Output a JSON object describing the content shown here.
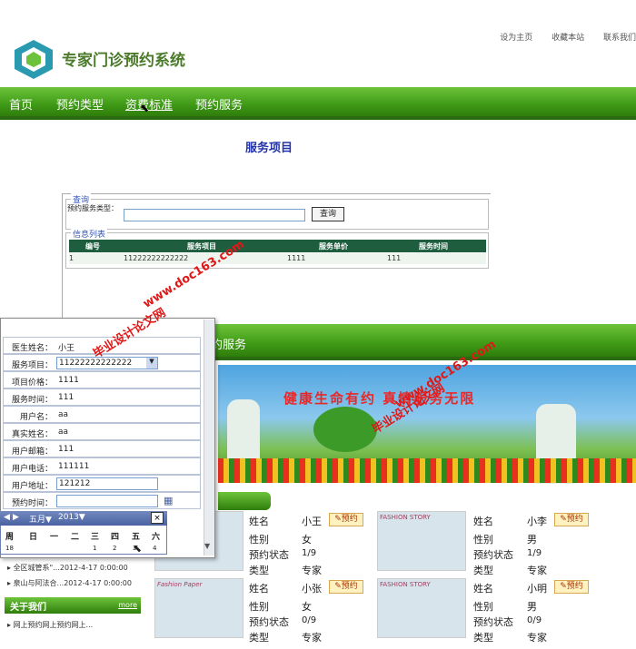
{
  "top": {
    "links": [
      "设为主页",
      "收藏本站",
      "联系我们"
    ],
    "site_title": "专家门诊预约系统",
    "nav": [
      "首页",
      "预约类型",
      "资费标准",
      "预约服务"
    ],
    "page_title": "服务项目",
    "query_legend": "查询",
    "query_label": "预约服务类型：",
    "query_button": "查询",
    "list_legend": "信息列表",
    "columns": [
      "编号",
      "服务项目",
      "服务单价",
      "服务时间"
    ],
    "rows": [
      [
        "1",
        "11222222222222",
        "1111",
        "111"
      ]
    ]
  },
  "watermarks": [
    "www.doc163.com",
    "毕业设计论文网",
    "www.doc163.com",
    "毕业设计论文网"
  ],
  "bottom": {
    "nav_partial": "约服务",
    "banner_text": "健康生命有约 真情服务无限",
    "form": [
      {
        "label": "医生姓名：",
        "value": "小王"
      },
      {
        "label": "服务项目：",
        "value": "11222222222222"
      },
      {
        "label": "项目价格：",
        "value": "1111"
      },
      {
        "label": "服务时间：",
        "value": "111"
      },
      {
        "label": "用户名：",
        "value": "aa"
      },
      {
        "label": "真实姓名：",
        "value": "aa"
      },
      {
        "label": "用户邮箱：",
        "value": "111"
      },
      {
        "label": "用户电话：",
        "value": "111111"
      },
      {
        "label": "用户地址：",
        "value": "121212"
      },
      {
        "label": "预约时间：",
        "value": ""
      }
    ],
    "calendar": {
      "month": "五月",
      "year": "2013",
      "weekdays": [
        "周",
        "日",
        "一",
        "二",
        "三",
        "四",
        "五",
        "六"
      ],
      "row": [
        "18",
        "",
        "",
        "",
        "1",
        "2",
        "3",
        "4"
      ],
      "close": "×"
    },
    "news": [
      "全区城管系\"...2012-4-17 0:00:00",
      "泉山与阿法合...2012-4-17 0:00:00"
    ],
    "about_title": "关于我们",
    "about_more": "more",
    "about_item": "网上预约网上预约网上...",
    "doctors": [
      {
        "name": "小王",
        "gender": "女",
        "status": "1/9",
        "type": "专家"
      },
      {
        "name": "小李",
        "gender": "男",
        "status": "1/9",
        "type": "专家"
      },
      {
        "name": "小张",
        "gender": "女",
        "status": "0/9",
        "type": "专家"
      },
      {
        "name": "小明",
        "gender": "男",
        "status": "0/9",
        "type": "专家"
      }
    ],
    "doctor_labels": {
      "name": "姓名",
      "gender": "性别",
      "status": "预约状态",
      "type": "类型"
    },
    "book_label": "预约",
    "card_img_captions": [
      "FASHION STORY",
      "FASHION STORY",
      "Fashion Paper",
      "FASHION STORY"
    ]
  },
  "colors": {
    "green": "#3f9a16",
    "blue_title": "#2233aa",
    "table_head": "#1e5d3e",
    "watermark": "#e01818"
  }
}
